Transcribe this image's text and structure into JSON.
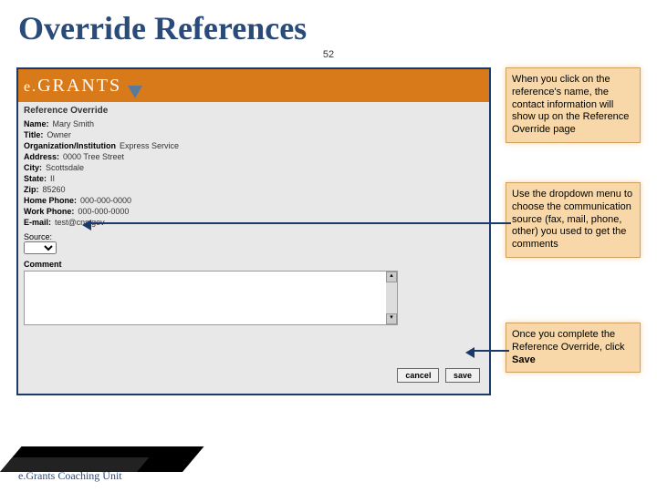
{
  "slide": {
    "title": "Override References",
    "page": "52"
  },
  "app": {
    "logo_prefix": "e.",
    "logo_main": "GRANTS",
    "section": "Reference Override",
    "fields": {
      "name_label": "Name:",
      "name_value": "Mary Smith",
      "title_label": "Title:",
      "title_value": "Owner",
      "org_label": "Organization/Institution",
      "org_value": "Express Service",
      "address_label": "Address:",
      "address_value": "0000 Tree Street",
      "city_label": "City:",
      "city_value": "Scottsdale",
      "state_label": "State:",
      "state_value": "II",
      "zip_label": "Zip:",
      "zip_value": "85260",
      "home_label": "Home Phone:",
      "home_value": "000-000-0000",
      "work_label": "Work Phone:",
      "work_value": "000-000-0000",
      "email_label": "E-mail:",
      "email_value": "test@cns.gov"
    },
    "source_label": "Source:",
    "comment_label": "Comment",
    "cancel_label": "cancel",
    "save_label": "save"
  },
  "callouts": {
    "c1": "When you click on the reference's name, the contact information will show up on the Reference Override page",
    "c2": "Use the dropdown menu to choose the communication source (fax, mail, phone, other) you used to get the comments",
    "c3a": "Once you complete the Reference Override, click ",
    "c3b": "Save"
  },
  "footer": "e.Grants Coaching Unit"
}
